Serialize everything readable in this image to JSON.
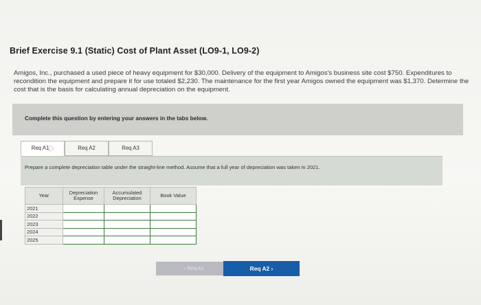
{
  "exercise": {
    "title": "Brief Exercise 9.1 (Static) Cost of Plant Asset (LO9-1, LO9-2)",
    "intro": "Amigos, Inc., purchased a used piece of heavy equipment for $30,000. Delivery of the equipment to Amigos's business site cost $750. Expenditures to recondition the equipment and prepare it for use totaled $2,230. The maintenance for the first year Amigos owned the equipment was $1,370. Determine the cost that is the basis for calculating annual depreciation on the equipment."
  },
  "instruction": "Complete this question by entering your answers in the tabs below.",
  "tabs": [
    {
      "label": "Req A1"
    },
    {
      "label": "Req A2"
    },
    {
      "label": "Req A3"
    }
  ],
  "prompt": "Prepare a complete depreciation table under the straight-line method. Assume that a full year of depreciation was taken in 2021.",
  "table": {
    "headers": {
      "year": "Year",
      "dep_expense": "Depreciation Expense",
      "acc_dep": "Accumulated Depreciation",
      "book_value": "Book Value"
    },
    "years": [
      "2021",
      "2022",
      "2023",
      "2024",
      "2025"
    ]
  },
  "nav": {
    "prev_label": "‹  Req A1",
    "next_label": "Req A2  ›"
  }
}
